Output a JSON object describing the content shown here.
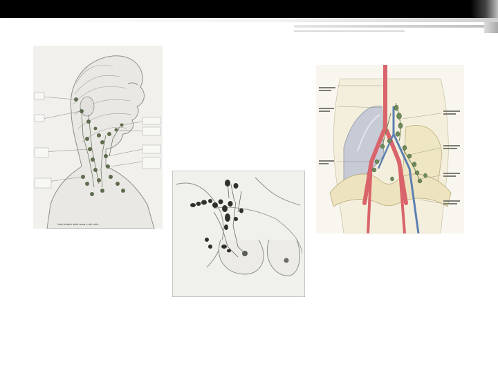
{
  "slide": {
    "figures": [
      {
        "name": "head-neck-lymph-nodes",
        "labels_left": [
          "Gruppo ...",
          "Gangli ...",
          "Gangli ...",
          "Gangli ..."
        ],
        "labels_right": [
          "Gangli ...",
          "Gangli ...",
          "Gangli ...",
          "Gangli ..."
        ],
        "caption": "Vasi linfatici della testa e del collo"
      },
      {
        "name": "breast-axillary-lymph-nodes"
      },
      {
        "name": "pelvic-lymph-nodes",
        "labels_left": [
          "Aorta ...",
          "Vena ...",
          "Gangli ..."
        ],
        "labels_right": [
          "Gangli ...",
          "Gangli ...",
          "Gangli ...",
          "Gangli ..."
        ]
      }
    ]
  }
}
